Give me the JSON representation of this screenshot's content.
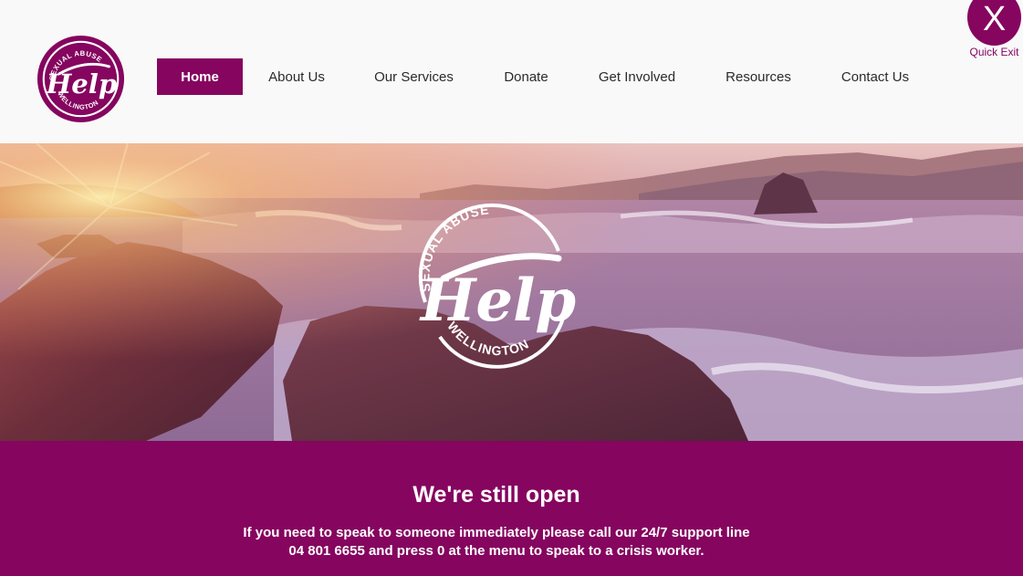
{
  "brand": {
    "logo_top": "SEXUAL ABUSE",
    "logo_main": "Help",
    "logo_bottom": "WELLINGTON",
    "primary_color": "#85055f"
  },
  "nav": {
    "items": [
      {
        "label": "Home",
        "active": true
      },
      {
        "label": "About Us"
      },
      {
        "label": "Our Services"
      },
      {
        "label": "Donate"
      },
      {
        "label": "Get Involved"
      },
      {
        "label": "Resources"
      },
      {
        "label": "Contact Us"
      }
    ]
  },
  "quick_exit": {
    "symbol": "X",
    "label": "Quick Exit"
  },
  "hero": {
    "image": "sunset-rocky-shore-waves"
  },
  "banner": {
    "title": "We're still open",
    "text": "If you need to speak to someone immediately please call our 24/7 support line 04 801 6655 and press 0 at the menu to speak to a crisis worker."
  }
}
